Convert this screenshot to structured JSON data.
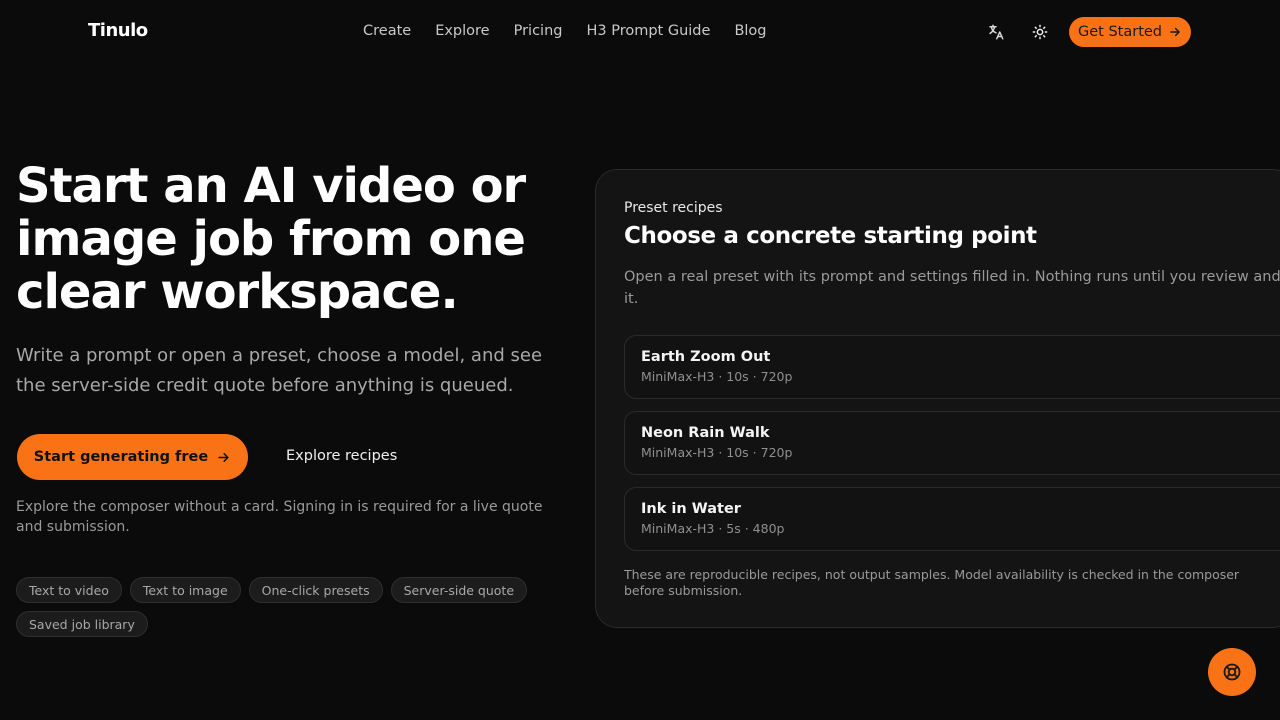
{
  "brand": {
    "name": "Tinulo",
    "accent": "#f97316"
  },
  "nav": {
    "items": [
      {
        "label": "Create"
      },
      {
        "label": "Explore"
      },
      {
        "label": "Pricing"
      },
      {
        "label": "H3 Prompt Guide"
      },
      {
        "label": "Blog"
      }
    ],
    "icons": {
      "translate": "translate-icon",
      "theme": "sun-icon"
    },
    "cta": "Get Started"
  },
  "hero": {
    "title": "Start an AI video or image job from one clear workspace.",
    "subtitle": "Write a prompt or open a preset, choose a model, and see the server-side credit quote before anything is queued.",
    "primary_cta": "Start generating free",
    "secondary_cta": "Explore recipes",
    "note": "Explore the composer without a card. Signing in is required for a live quote and submission.",
    "chips": [
      "Text to video",
      "Text to image",
      "One-click presets",
      "Server-side quote",
      "Saved job library"
    ]
  },
  "panel": {
    "kicker": "Preset recipes",
    "title": "Choose a concrete starting point",
    "description_line1": "Open a real preset with its prompt and settings filled in. Nothing runs until you review and sub",
    "description_line2": "it.",
    "recipes": [
      {
        "title": "Earth Zoom Out",
        "meta": "MiniMax-H3 · 10s · 720p"
      },
      {
        "title": "Neon Rain Walk",
        "meta": "MiniMax-H3 · 10s · 720p"
      },
      {
        "title": "Ink in Water",
        "meta": "MiniMax-H3 · 5s · 480p"
      }
    ],
    "footnote": "These are reproducible recipes, not output samples. Model availability is checked in the composer before submission."
  },
  "help": {
    "icon": "lifebuoy-icon"
  }
}
